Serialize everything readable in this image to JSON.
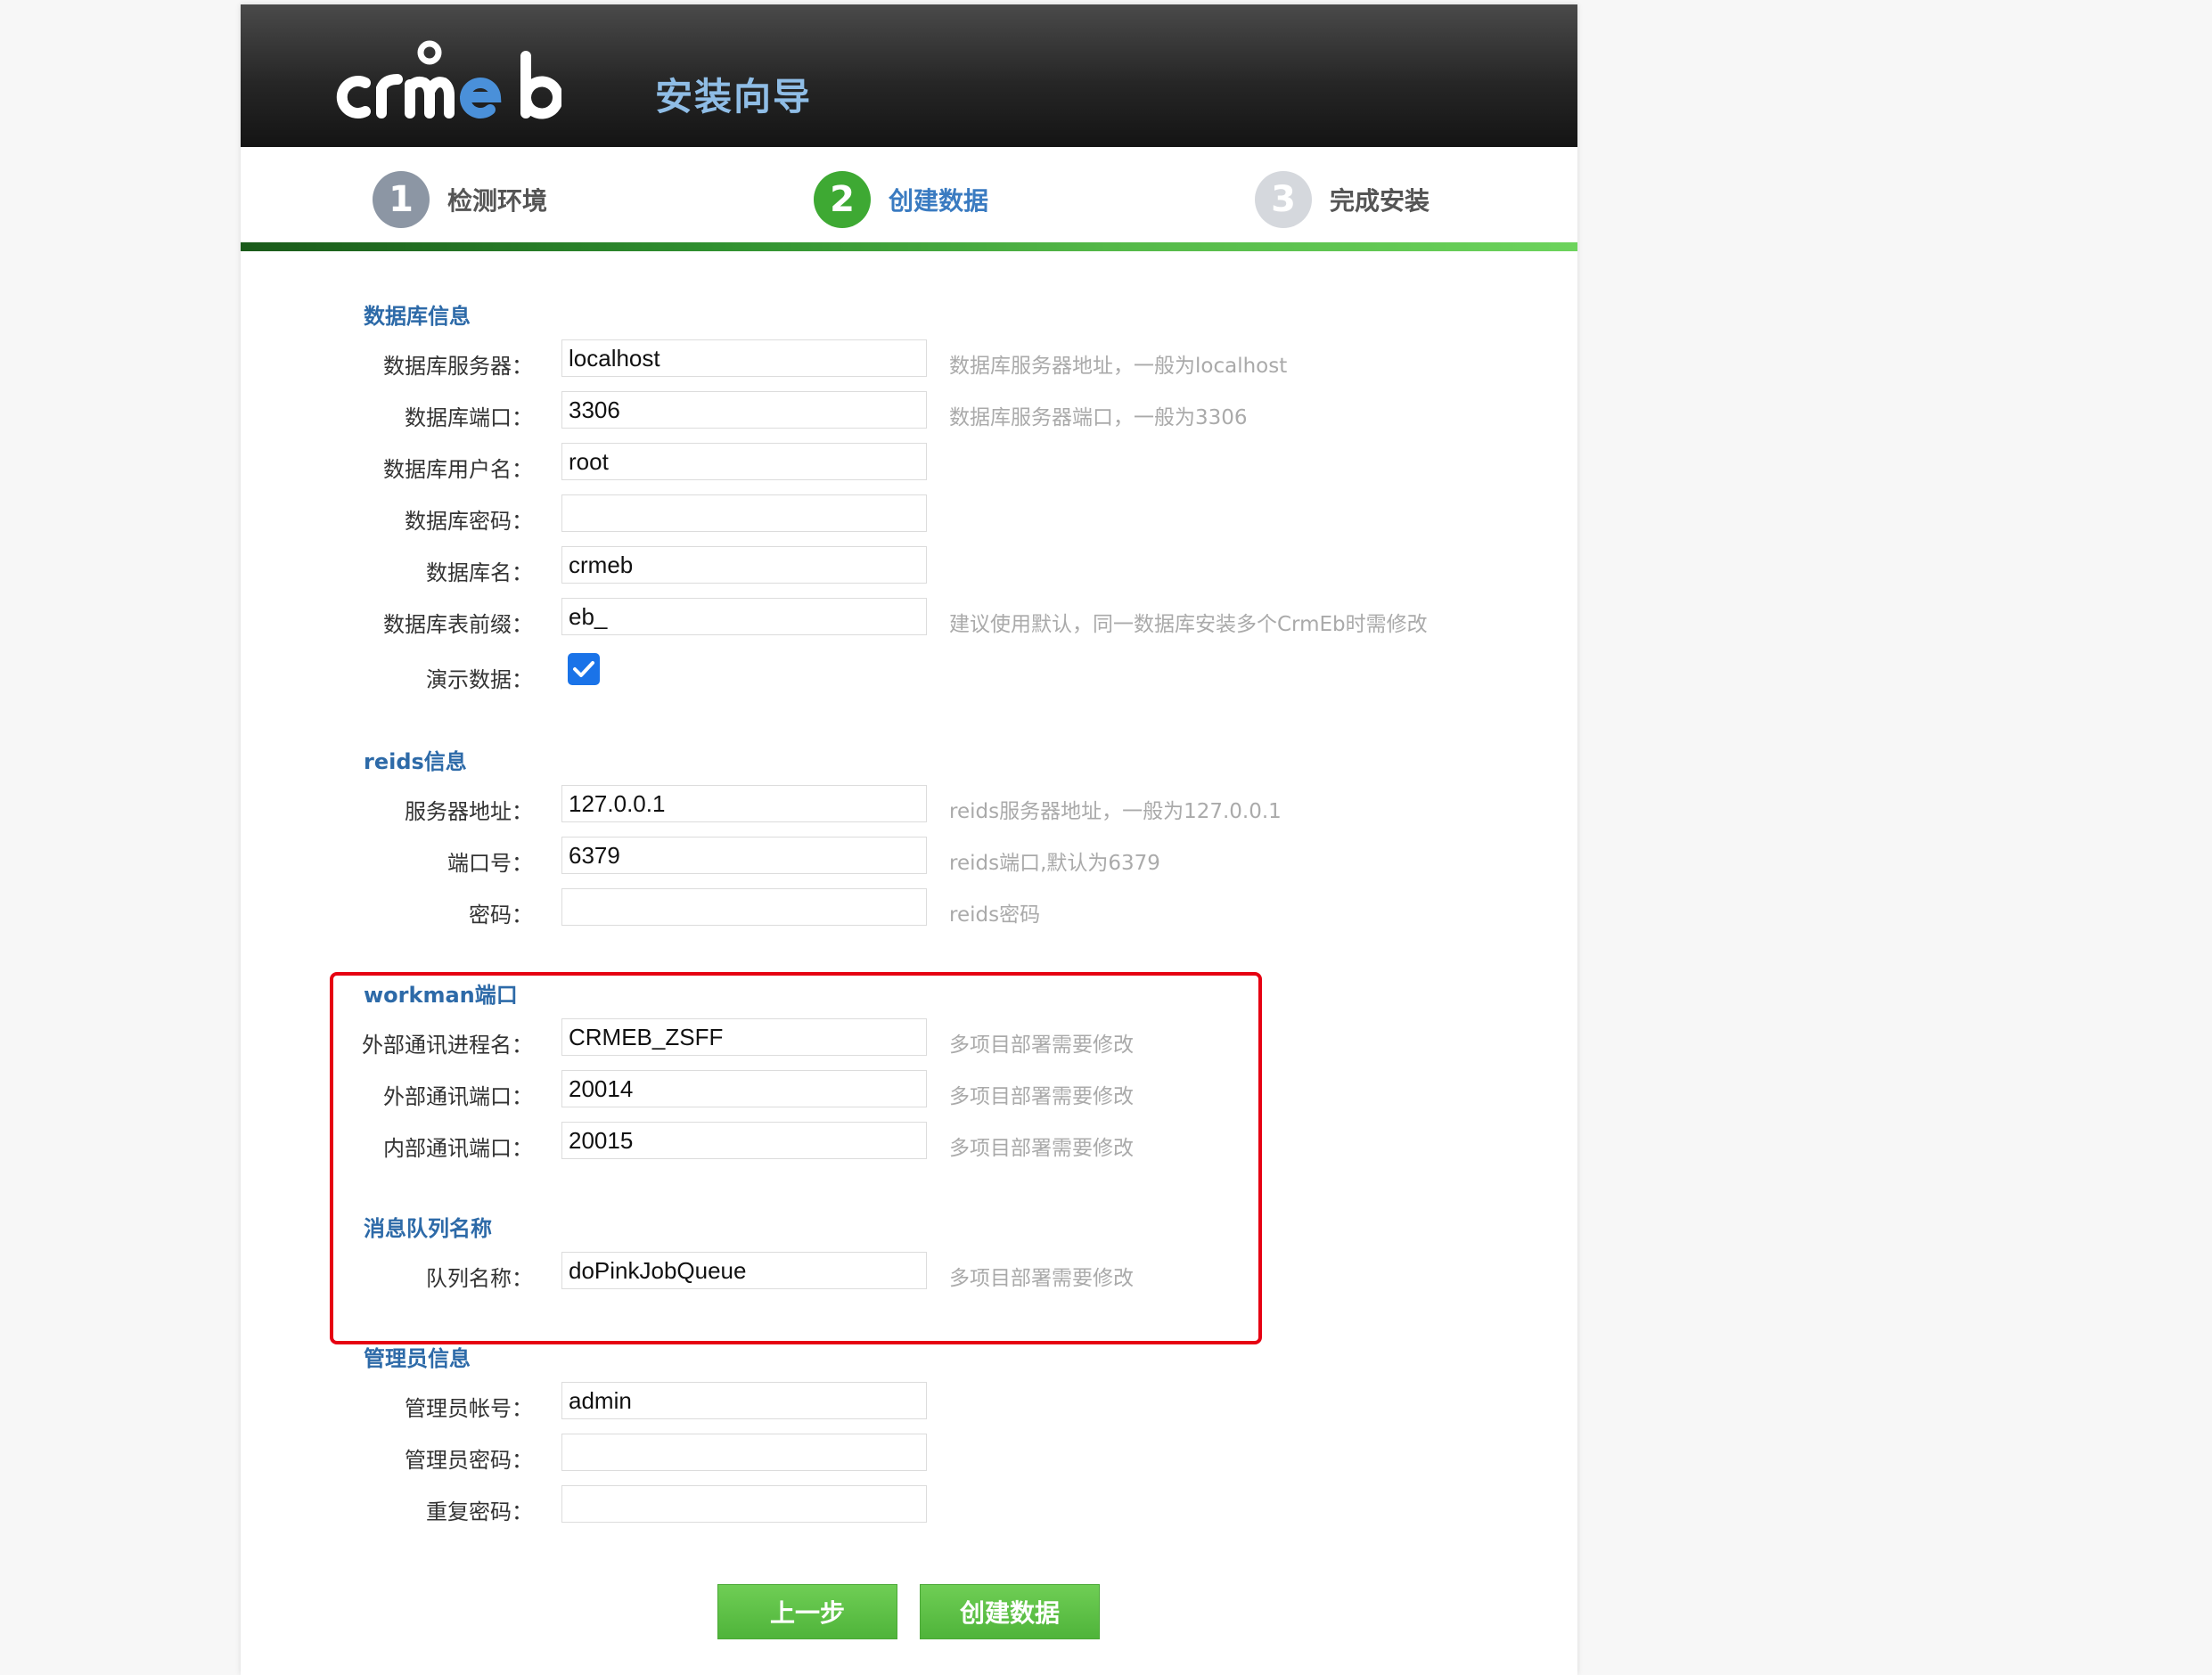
{
  "header": {
    "logo_text": "crmeb",
    "title": "安装向导"
  },
  "steps": [
    {
      "num": "1",
      "label": "检测环境",
      "state": "done"
    },
    {
      "num": "2",
      "label": "创建数据",
      "state": "active"
    },
    {
      "num": "3",
      "label": "完成安装",
      "state": "pending"
    }
  ],
  "database": {
    "title": "数据库信息",
    "fields": [
      {
        "label": "数据库服务器：",
        "value": "localhost",
        "hint": "数据库服务器地址，一般为localhost"
      },
      {
        "label": "数据库端口：",
        "value": "3306",
        "hint": "数据库服务器端口，一般为3306"
      },
      {
        "label": "数据库用户名：",
        "value": "root",
        "hint": ""
      },
      {
        "label": "数据库密码：",
        "value": "",
        "hint": ""
      },
      {
        "label": "数据库名：",
        "value": "crmeb",
        "hint": ""
      },
      {
        "label": "数据库表前缀：",
        "value": "eb_",
        "hint": "建议使用默认，同一数据库安装多个CrmEb时需修改"
      }
    ],
    "demo_label": "演示数据：",
    "demo_checked": true
  },
  "redis": {
    "title": "reids信息",
    "fields": [
      {
        "label": "服务器地址：",
        "value": "127.0.0.1",
        "hint": "reids服务器地址，一般为127.0.0.1"
      },
      {
        "label": "端口号：",
        "value": "6379",
        "hint": "reids端口,默认为6379"
      },
      {
        "label": "密码：",
        "value": "",
        "hint": "reids密码"
      }
    ]
  },
  "workman": {
    "title": "workman端口",
    "fields": [
      {
        "label": "外部通讯进程名：",
        "value": "CRMEB_ZSFF",
        "hint": "多项目部署需要修改"
      },
      {
        "label": "外部通讯端口：",
        "value": "20014",
        "hint": "多项目部署需要修改"
      },
      {
        "label": "内部通讯端口：",
        "value": "20015",
        "hint": "多项目部署需要修改"
      }
    ]
  },
  "queue": {
    "title": "消息队列名称",
    "fields": [
      {
        "label": "队列名称：",
        "value": "doPinkJobQueue",
        "hint": "多项目部署需要修改"
      }
    ]
  },
  "admin": {
    "title": "管理员信息",
    "fields": [
      {
        "label": "管理员帐号：",
        "value": "admin",
        "hint": ""
      },
      {
        "label": "管理员密码：",
        "value": "",
        "hint": ""
      },
      {
        "label": "重复密码：",
        "value": "",
        "hint": ""
      }
    ]
  },
  "buttons": {
    "prev": "上一步",
    "create": "创建数据"
  },
  "colors": {
    "accent_green": "#4fb43a",
    "section_blue": "#2d6aa8",
    "highlight_red": "#e60012",
    "checkbox_blue": "#1a73e8"
  }
}
